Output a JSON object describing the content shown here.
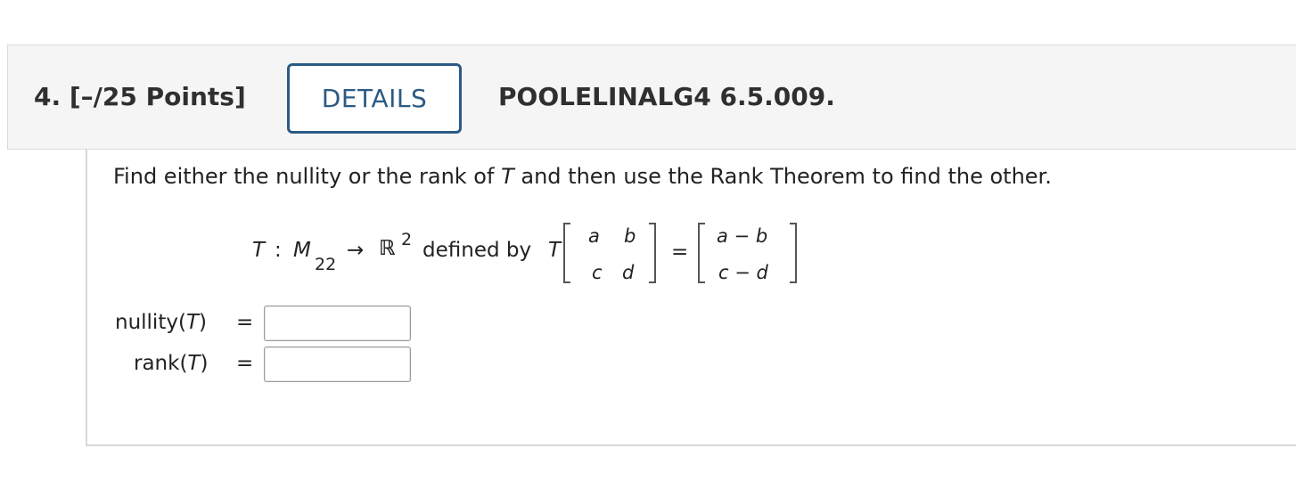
{
  "question": {
    "number_points": "4. [–/25 Points]",
    "details_label": "DETAILS",
    "reference": "POOLELINALG4 6.5.009."
  },
  "prompt": {
    "before": "Find either the nullity or the rank of ",
    "var": "T",
    "after": " and then use the Rank Theorem to find the other."
  },
  "math": {
    "T": "T",
    "colon": ":",
    "M": "M",
    "M_sub": "22",
    "arrow": "→",
    "R": "ℝ",
    "R_sup": "2",
    "defined_by": "defined by",
    "T2": "T",
    "equals": "=",
    "lhs_matrix": [
      [
        "a",
        "b"
      ],
      [
        "c",
        "d"
      ]
    ],
    "rhs_vector": [
      "a − b",
      "c − d"
    ]
  },
  "answers": [
    {
      "label_prefix": "nullity(",
      "label_var": "T",
      "label_suffix": ")",
      "equals": "=",
      "value": ""
    },
    {
      "label_prefix": "rank(",
      "label_var": "T",
      "label_suffix": ")",
      "equals": "=",
      "value": ""
    }
  ]
}
